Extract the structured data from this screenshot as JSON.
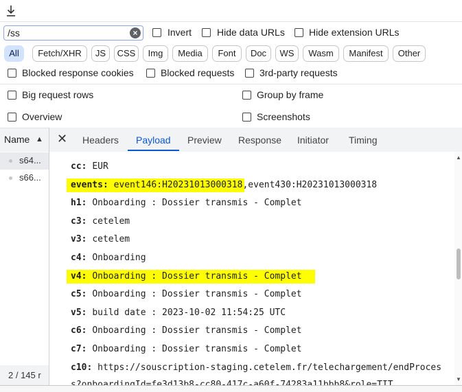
{
  "toolbar": {
    "download_icon": "download-icon"
  },
  "filter": {
    "value": "/ss",
    "options": [
      {
        "label": "Invert",
        "checked": false
      },
      {
        "label": "Hide data URLs",
        "checked": false
      },
      {
        "label": "Hide extension URLs",
        "checked": false
      }
    ]
  },
  "types": [
    "All",
    "Fetch/XHR",
    "JS",
    "CSS",
    "Img",
    "Media",
    "Font",
    "Doc",
    "WS",
    "Wasm",
    "Manifest",
    "Other"
  ],
  "active_type": "All",
  "toggles": {
    "blocked_cookies": "Blocked response cookies",
    "blocked_requests": "Blocked requests",
    "third_party": "3rd-party requests",
    "big_rows": "Big request rows",
    "group_by_frame": "Group by frame",
    "overview": "Overview",
    "screenshots": "Screenshots"
  },
  "requests": {
    "header": "Name",
    "items": [
      "s64...",
      "s66..."
    ],
    "status": "2 / 145 r"
  },
  "tabs": [
    "Headers",
    "Payload",
    "Preview",
    "Response",
    "Initiator",
    "Timing"
  ],
  "active_tab": "Payload",
  "payload": [
    {
      "key": "cc:",
      "value": "EUR"
    },
    {
      "key": "events:",
      "value": "event146:H20231013000318,event430:H20231013000318"
    },
    {
      "key": "h1:",
      "value": "Onboarding : Dossier transmis - Complet"
    },
    {
      "key": "c3:",
      "value": "cetelem"
    },
    {
      "key": "v3:",
      "value": "cetelem"
    },
    {
      "key": "c4:",
      "value": "Onboarding"
    },
    {
      "key": "v4:",
      "value": "Onboarding : Dossier transmis - Complet"
    },
    {
      "key": "c5:",
      "value": "Onboarding : Dossier transmis - Complet"
    },
    {
      "key": "v5:",
      "value": "build date : 2023-10-02 11:54:25 UTC"
    },
    {
      "key": "c6:",
      "value": "Onboarding : Dossier transmis - Complet"
    },
    {
      "key": "c7:",
      "value": "Onboarding : Dossier transmis - Complet"
    },
    {
      "key": "c10:",
      "value": "https://souscription-staging.cetelem.fr/telechargement/endProces"
    },
    {
      "key": "",
      "value": "s?onboardingId=fe3d13b8-cc80-417c-a60f-74283a11bbb8&role=TIT"
    }
  ],
  "highlight_color": "#ffff00"
}
